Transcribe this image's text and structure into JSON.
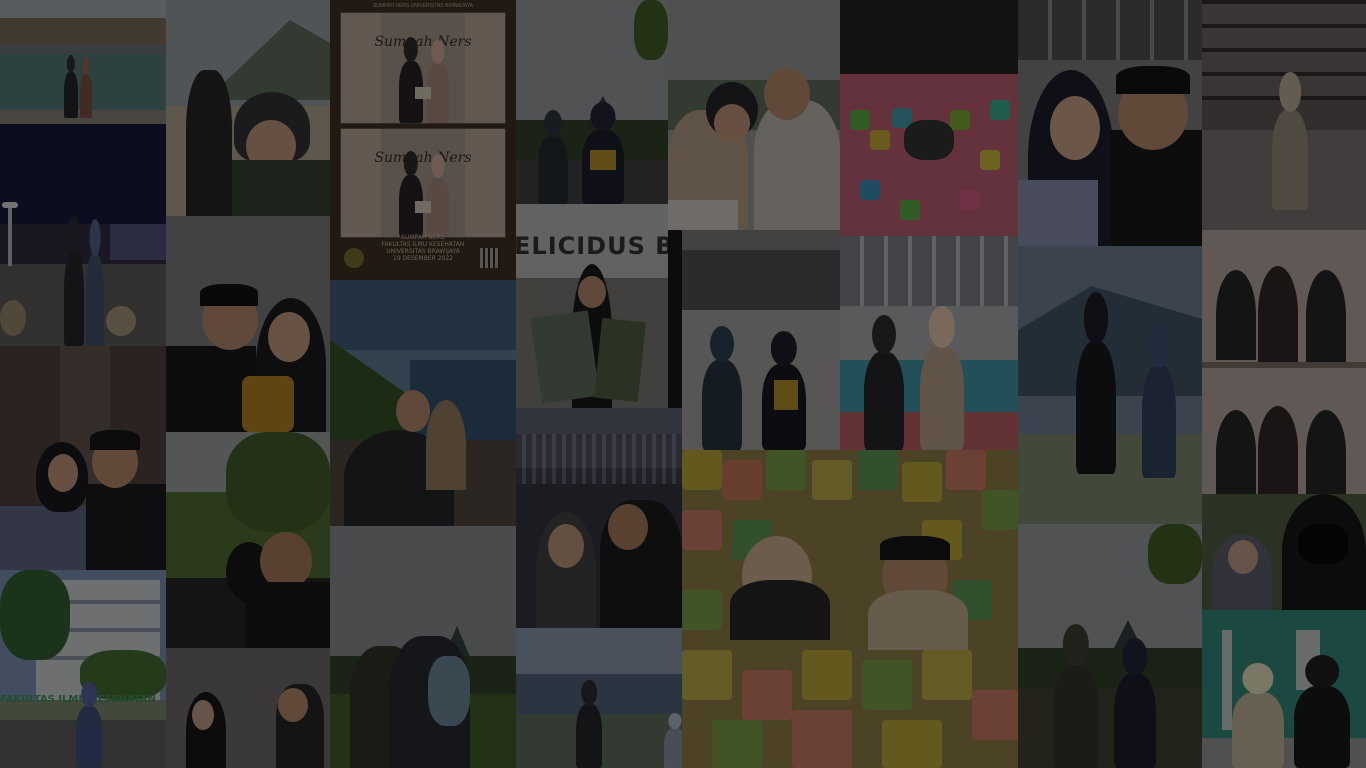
{
  "page": {
    "title": "",
    "overlay_color": "#000000"
  },
  "collage": {
    "tiles": [
      {
        "id": "tile-pool-couple",
        "subject": "couple-by-pool-photo"
      },
      {
        "id": "tile-night-plaza",
        "subject": "couple-at-night-plaza-photo"
      },
      {
        "id": "tile-couple-indoor-1",
        "subject": "couple-selfie-indoor-photo"
      },
      {
        "id": "tile-campus-building",
        "subject": "campus-building-photo"
      },
      {
        "id": "tile-helmet-selfie-1",
        "subject": "helmet-selfie-mountain-photo"
      },
      {
        "id": "tile-honey-jar",
        "subject": "couple-with-honey-jar-photo"
      },
      {
        "id": "tile-field-selfie",
        "subject": "field-selfie-photo"
      },
      {
        "id": "tile-couple-indoor-2",
        "subject": "couple-indoor-photo"
      },
      {
        "id": "tile-certificate",
        "subject": "sumpah-ners-certificate-photo"
      },
      {
        "id": "tile-cliff-selfie",
        "subject": "cliff-selfie-photo"
      },
      {
        "id": "tile-temple-hug",
        "subject": "couple-hug-temple-photo"
      },
      {
        "id": "tile-graduation-temple",
        "subject": "graduation-temple-photo"
      },
      {
        "id": "tile-delicious-sign",
        "subject": "delicious-sign-photo"
      },
      {
        "id": "tile-concert-selfie",
        "subject": "concert-crowd-selfie-photo"
      },
      {
        "id": "tile-lake-walk",
        "subject": "lakeside-walk-photo"
      },
      {
        "id": "tile-helmet-selfie-2",
        "subject": "helmet-selfie-photo"
      },
      {
        "id": "tile-graduation-pair",
        "subject": "graduation-pair-photo"
      },
      {
        "id": "tile-foam-pit-1",
        "subject": "foam-pit-overhead-photo"
      },
      {
        "id": "tile-court-pose",
        "subject": "couple-posing-court-photo"
      },
      {
        "id": "tile-foam-pit-2",
        "subject": "foam-pit-couple-photo"
      },
      {
        "id": "tile-couple-kiss",
        "subject": "couple-selfie-photo"
      },
      {
        "id": "tile-mountain-walk",
        "subject": "mountain-walk-photo"
      },
      {
        "id": "tile-temple-crowd",
        "subject": "temple-crowd-photo"
      },
      {
        "id": "tile-corridor-figure",
        "subject": "corridor-figure-photo"
      },
      {
        "id": "tile-masked-strip",
        "subject": "masked-photo-strip"
      },
      {
        "id": "tile-masked-pair",
        "subject": "masked-couple-photo"
      },
      {
        "id": "tile-teal-wall",
        "subject": "teal-wall-couple-photo"
      }
    ]
  },
  "certificate": {
    "panel_title": "Sumpah Ners",
    "top_text": "SUMPAH NERS UNIVERSITAS BRAWIJAYA",
    "footer_line1": "SUMPAH NERS",
    "footer_line2": "FAKULTAS ILMU KESEHATAN",
    "footer_line3": "UNIVERSITAS BRAWIJAYA",
    "footer_line4": "19 DESEMBER 2022"
  },
  "signage": {
    "restaurant_sign": "ELICIDUS BU",
    "campus_sign": "FAKULTAS ILMU KESEHATAN"
  }
}
